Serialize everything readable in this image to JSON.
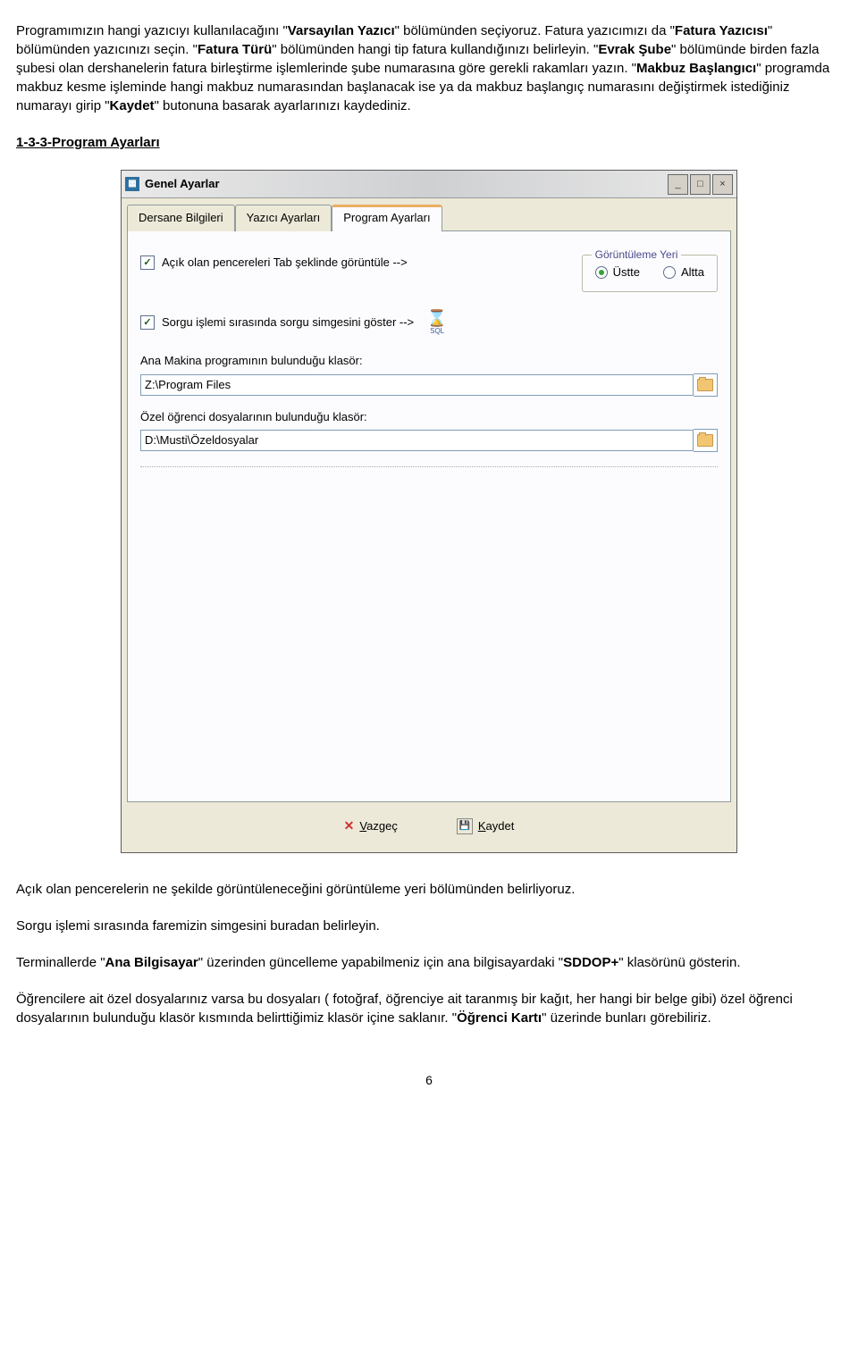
{
  "paragraphs": {
    "intro": "Programımızın hangi yazıcıyı kullanılacağını \"Varsayılan Yazıcı\" bölümünden seçiyoruz. Fatura yazıcımızı da \"Fatura Yazıcısı\" bölümünden yazıcınızı seçin. \"Fatura Türü\" bölümünden hangi tip fatura kullandığınızı belirleyin. \"Evrak Şube\" bölümünde birden fazla şubesi olan dershanelerin fatura birleştirme işlemlerinde şube numarasına göre gerekli rakamları yazın. \"Makbuz Başlangıcı\" programda makbuz kesme işleminde hangi makbuz numarasından başlanacak ise ya da makbuz başlangıç numarasını değiştirmek istediğiniz numarayı girip \"Kaydet\" butonuna basarak ayarlarınızı kaydediniz.",
    "heading": "1-3-3-Program Ayarları",
    "p1": "Açık olan pencerelerin ne şekilde görüntüleneceğini görüntüleme yeri bölümünden belirliyoruz.",
    "p2": "Sorgu işlemi sırasında faremizin simgesini buradan belirleyin.",
    "p3a": "Terminallerde \"",
    "p3bold1": "Ana Bilgisayar",
    "p3b": "\" üzerinden güncelleme yapabilmeniz için ana bilgisayardaki \"",
    "p3bold2": "SDDOP+",
    "p3c": "\" klasörünü gösterin.",
    "p4a": "Öğrencilere ait özel dosyalarınız varsa bu dosyaları ( fotoğraf, öğrenciye ait taranmış bir kağıt, her hangi bir belge gibi) özel öğrenci dosyalarının bulunduğu klasör kısmında belirttiğimiz klasör içine saklanır. \"",
    "p4bold": "Öğrenci Kartı",
    "p4b": "\" üzerinde bunları görebiliriz."
  },
  "window": {
    "title": "Genel Ayarlar",
    "tabs": {
      "t1": "Dersane Bilgileri",
      "t2": "Yazıcı Ayarları",
      "t3": "Program Ayarları"
    },
    "chk1": "Açık olan pencereleri Tab şeklinde görüntüle -->",
    "groupLegend": "Görüntüleme Yeri",
    "radio1": "Üstte",
    "radio2": "Altta",
    "chk2": "Sorgu işlemi sırasında sorgu simgesini göster -->",
    "sqlLabel": "SQL",
    "lbl1": "Ana Makina programının bulunduğu klasör:",
    "input1": "Z:\\Program Files",
    "lbl2": "Özel öğrenci dosyalarının bulunduğu klasör:",
    "input2": "D:\\Musti\\Özeldosyalar",
    "btnCancel": "Vazgeç",
    "btnSave": "Kaydet"
  },
  "pageNumber": "6"
}
